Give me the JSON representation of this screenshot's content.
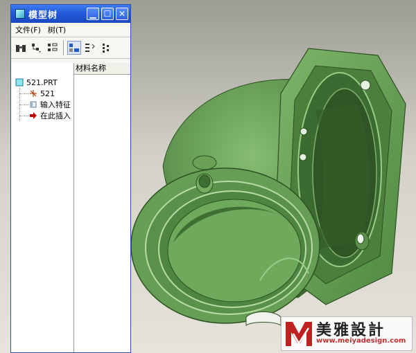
{
  "window": {
    "title": "模型树"
  },
  "menu": {
    "file": "文件(F)",
    "tree": "树(T)"
  },
  "attr_column": {
    "header": "材料名称"
  },
  "tree": {
    "root": "521.PRT",
    "items": [
      "521",
      "输入特征",
      "在此插入"
    ]
  },
  "watermark": {
    "name": "美雅設計",
    "url": "www.meiyadesign.com"
  },
  "colors": {
    "titlebar": "#2157d8",
    "model": "#6fa35c",
    "model_shadow": "#2d5022",
    "insert_arrow": "#c00000"
  }
}
